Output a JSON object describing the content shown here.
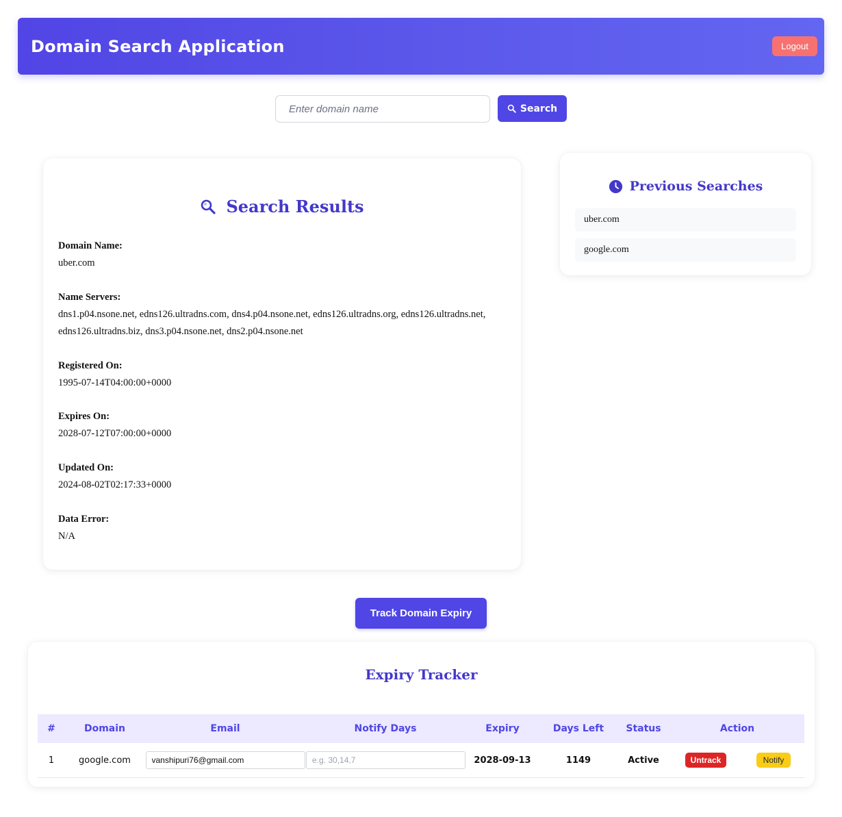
{
  "header": {
    "title": "Domain Search Application",
    "logout_label": "Logout"
  },
  "search": {
    "placeholder": "Enter domain name",
    "value": "",
    "button_label": "Search",
    "button_icon": "search-icon"
  },
  "results": {
    "title": "Search Results",
    "title_icon": "search-icon",
    "fields": [
      {
        "label": "Domain Name:",
        "value": "uber.com"
      },
      {
        "label": "Name Servers:",
        "value": "dns1.p04.nsone.net, edns126.ultradns.com, dns4.p04.nsone.net, edns126.ultradns.org, edns126.ultradns.net, edns126.ultradns.biz, dns3.p04.nsone.net, dns2.p04.nsone.net"
      },
      {
        "label": "Registered On:",
        "value": "1995-07-14T04:00:00+0000"
      },
      {
        "label": "Expires On:",
        "value": "2028-07-12T07:00:00+0000"
      },
      {
        "label": "Updated On:",
        "value": "2024-08-02T02:17:33+0000"
      },
      {
        "label": "Data Error:",
        "value": "N/A"
      }
    ]
  },
  "previous": {
    "title": "Previous Searches",
    "title_icon": "clock-icon",
    "items": [
      "uber.com",
      "google.com"
    ]
  },
  "track_button_label": "Track Domain Expiry",
  "tracker": {
    "title": "Expiry Tracker",
    "columns": [
      "#",
      "Domain",
      "Email",
      "Notify Days",
      "Expiry",
      "Days Left",
      "Status",
      "Action"
    ],
    "rows": [
      {
        "index": "1",
        "domain": "google.com",
        "email": "vanshipuri76@gmail.com",
        "notify_days": "",
        "notify_placeholder": "e.g. 30,14,7",
        "expiry": "2028-09-13",
        "days_left": "1149",
        "status": "Active",
        "untrack_label": "Untrack",
        "notify_label": "Notify"
      }
    ]
  },
  "colors": {
    "primary": "#4f46e5",
    "heading": "#4338ca",
    "logout": "#f87171",
    "untrack": "#dc2626",
    "notify": "#facc15",
    "status_active": "#15803d",
    "expiry": "#c2410c",
    "days_left": "#1d4ed8"
  }
}
